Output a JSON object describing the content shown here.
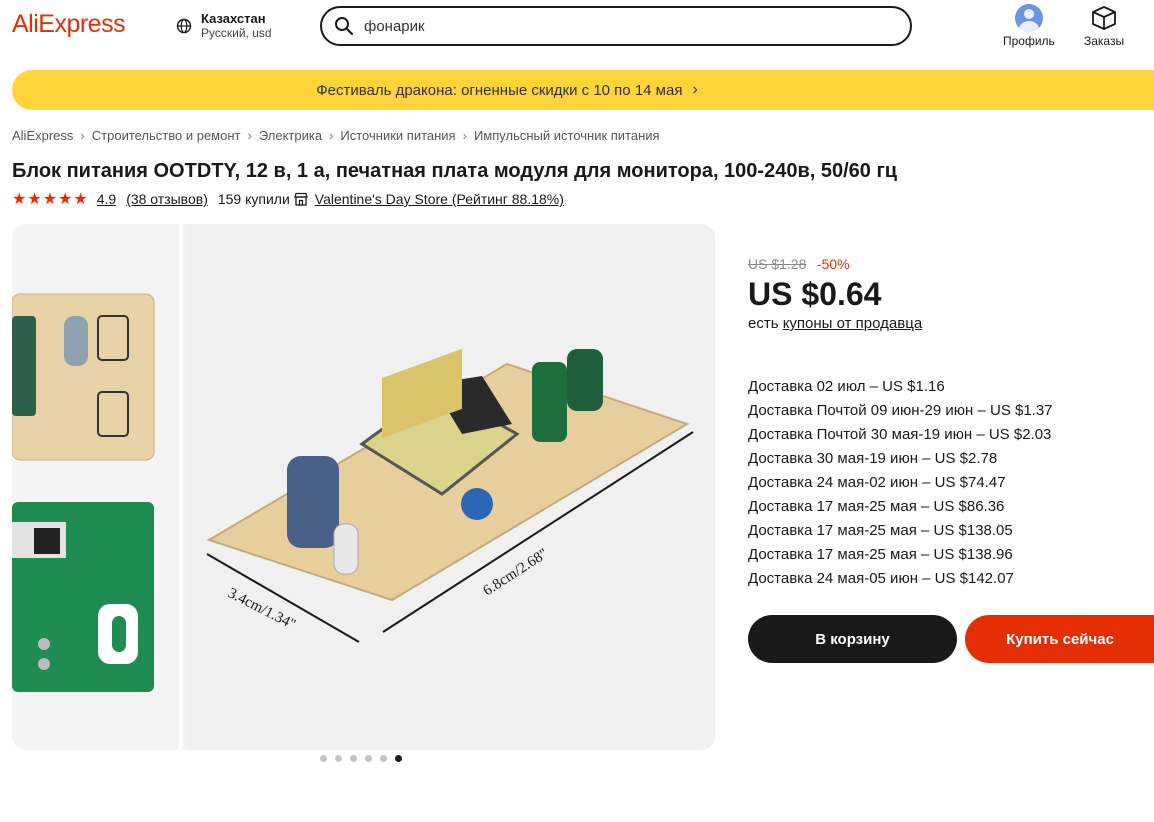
{
  "header": {
    "logo": "AliExpress",
    "region_country": "Казахстан",
    "region_sub": "Русский, usd",
    "search_value": "фонарик",
    "profile_label": "Профиль",
    "orders_label": "Заказы"
  },
  "banner": {
    "text": "Фестиваль дракона: огненные скидки с 10 по 14 мая"
  },
  "breadcrumb": [
    "AliExpress",
    "Строительство и ремонт",
    "Электрика",
    "Источники питания",
    "Импульсный источник питания"
  ],
  "product": {
    "title": "Блок питания OOTDTY, 12 в, 1 а, печатная плата модуля для монитора, 100-240в, 50/60 гц",
    "rating": "4.9",
    "reviews": "(38 отзывов)",
    "sold": "159 купили",
    "store": "Valentine's Day Store (Рейтинг 88.18%)",
    "image_dims": {
      "width": "3.4cm/1.34\"",
      "length": "6.8cm/2.68\""
    },
    "gallery_count": 6,
    "gallery_active_index": 5
  },
  "pricing": {
    "old_price": "US $1.28",
    "discount": "-50%",
    "price": "US $0.64",
    "coupon_prefix": "есть",
    "coupon_link": "купоны от продавца"
  },
  "shipping": [
    "Доставка 02 июл – US $1.16",
    "Доставка Почтой 09 июн-29 июн – US $1.37",
    "Доставка Почтой 30 мая-19 июн – US $2.03",
    "Доставка 30 мая-19 июн – US $2.78",
    "Доставка 24 мая-02 июн – US $74.47",
    "Доставка 17 мая-25 мая – US $86.36",
    "Доставка 17 мая-25 мая – US $138.05",
    "Доставка 17 мая-25 мая – US $138.96",
    "Доставка 24 мая-05 июн – US $142.07"
  ],
  "actions": {
    "cart": "В корзину",
    "buy": "Купить сейчас"
  },
  "colors": {
    "brand": "#e62e04",
    "banner": "#fdd53a",
    "dark": "#191919"
  }
}
